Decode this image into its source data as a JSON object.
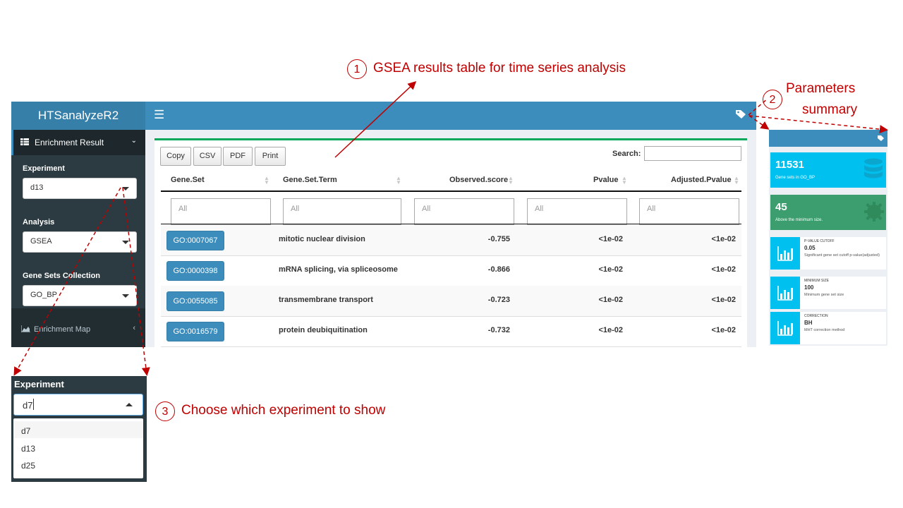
{
  "app": {
    "title": "HTSanalyzeR2"
  },
  "sidebar": {
    "menu_enrichment": "Enrichment Result",
    "menu_map": "Enrichment Map",
    "experiment": {
      "label": "Experiment",
      "value": "d13"
    },
    "analysis": {
      "label": "Analysis",
      "value": "GSEA"
    },
    "collection": {
      "label": "Gene Sets Collection",
      "value": "GO_BP"
    }
  },
  "toolbar": {
    "copy": "Copy",
    "csv": "CSV",
    "pdf": "PDF",
    "print": "Print",
    "search_label": "Search:"
  },
  "table": {
    "columns": [
      "Gene.Set",
      "Gene.Set.Term",
      "Observed.score",
      "Pvalue",
      "Adjusted.Pvalue"
    ],
    "filter_placeholder": "All",
    "rows": [
      {
        "gene_set": "GO:0007067",
        "term": "mitotic nuclear division",
        "score": "-0.755",
        "pvalue": "<1e-02",
        "adj": "<1e-02"
      },
      {
        "gene_set": "GO:0000398",
        "term": "mRNA splicing, via spliceosome",
        "score": "-0.866",
        "pvalue": "<1e-02",
        "adj": "<1e-02"
      },
      {
        "gene_set": "GO:0055085",
        "term": "transmembrane transport",
        "score": "-0.723",
        "pvalue": "<1e-02",
        "adj": "<1e-02"
      },
      {
        "gene_set": "GO:0016579",
        "term": "protein deubiquitination",
        "score": "-0.732",
        "pvalue": "<1e-02",
        "adj": "<1e-02"
      }
    ]
  },
  "annotations": {
    "one": {
      "num": "1",
      "text": "GSEA results table for time series analysis"
    },
    "two": {
      "num": "2",
      "line1": "Parameters",
      "line2": "summary"
    },
    "three": {
      "num": "3",
      "text": "Choose which experiment to show"
    }
  },
  "summary": {
    "genesets": {
      "value": "11531",
      "label": "Gene sets in GO_BP"
    },
    "minsize_above": {
      "value": "45",
      "label": "Above the minimum size."
    },
    "pvalue_cutoff": {
      "title": "P-VALUE CUTOFF",
      "value": "0.05",
      "desc": "Significant gene set cutoff p-value(adjusted)"
    },
    "min_size": {
      "title": "MINIMUM SIZE",
      "value": "100",
      "desc": "Minimum gene set size"
    },
    "correction": {
      "title": "CORRECTION",
      "value": "BH",
      "desc": "MHT correction method"
    }
  },
  "zoom": {
    "label": "Experiment",
    "typed": "d7",
    "options": [
      "d7",
      "d13",
      "d25"
    ]
  },
  "colors": {
    "header": "#3c8dbc",
    "sidebar": "#222d32",
    "accent_red": "#c00000",
    "aqua": "#00c0ef",
    "green": "#3c9e6e",
    "box_border": "#00a65a"
  }
}
